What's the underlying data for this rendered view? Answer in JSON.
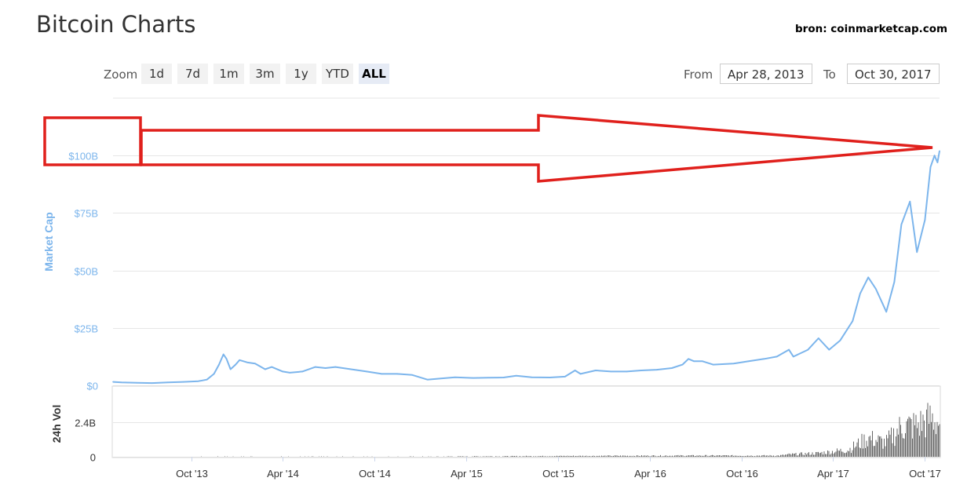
{
  "header": {
    "title": "Bitcoin Charts",
    "source": "bron: coinmarketcap.com"
  },
  "toolbar": {
    "zoom_label": "Zoom",
    "zoom_options": [
      "1d",
      "7d",
      "1m",
      "3m",
      "1y",
      "YTD",
      "ALL"
    ],
    "zoom_selected": "ALL",
    "from_label": "From",
    "from_value": "Apr 28, 2013",
    "to_label": "To",
    "to_value": "Oct 30, 2017"
  },
  "chart_data": [
    {
      "type": "line",
      "ylabel": "Market Cap",
      "y_ticks": [
        0,
        25,
        50,
        75,
        100
      ],
      "y_tick_labels": [
        "$0",
        "$25B",
        "$50B",
        "$75B",
        "$100B"
      ],
      "ylim": [
        0,
        125
      ],
      "y_unit": "billion USD",
      "xlim": [
        "2013-04-28",
        "2017-10-30"
      ],
      "x_ticks": [
        "2013-10-01",
        "2014-04-01",
        "2014-10-01",
        "2015-04-01",
        "2015-10-01",
        "2016-04-01",
        "2016-10-01",
        "2017-04-01",
        "2017-10-01"
      ],
      "x_tick_labels": [
        "Oct '13",
        "Apr '14",
        "Oct '14",
        "Apr '15",
        "Oct '15",
        "Apr '16",
        "Oct '16",
        "Apr '17",
        "Oct '17"
      ],
      "grid": true,
      "color": "#7cb5ec",
      "points": [
        [
          "2013-04-28",
          1.5
        ],
        [
          "2013-05-15",
          1.3
        ],
        [
          "2013-06-15",
          1.1
        ],
        [
          "2013-07-15",
          1.0
        ],
        [
          "2013-08-15",
          1.3
        ],
        [
          "2013-09-15",
          1.5
        ],
        [
          "2013-10-15",
          1.8
        ],
        [
          "2013-11-01",
          2.5
        ],
        [
          "2013-11-15",
          5.0
        ],
        [
          "2013-11-25",
          9.0
        ],
        [
          "2013-12-04",
          13.5
        ],
        [
          "2013-12-10",
          11.5
        ],
        [
          "2013-12-18",
          7.0
        ],
        [
          "2013-12-28",
          9.0
        ],
        [
          "2014-01-05",
          11.0
        ],
        [
          "2014-01-20",
          10.0
        ],
        [
          "2014-02-05",
          9.5
        ],
        [
          "2014-02-25",
          7.0
        ],
        [
          "2014-03-10",
          8.0
        ],
        [
          "2014-04-01",
          6.0
        ],
        [
          "2014-04-15",
          5.5
        ],
        [
          "2014-05-10",
          6.0
        ],
        [
          "2014-06-05",
          8.0
        ],
        [
          "2014-06-25",
          7.5
        ],
        [
          "2014-07-15",
          8.0
        ],
        [
          "2014-08-15",
          7.0
        ],
        [
          "2014-09-15",
          6.0
        ],
        [
          "2014-10-15",
          5.0
        ],
        [
          "2014-11-15",
          5.0
        ],
        [
          "2014-12-15",
          4.5
        ],
        [
          "2015-01-14",
          2.5
        ],
        [
          "2015-02-10",
          3.0
        ],
        [
          "2015-03-10",
          3.5
        ],
        [
          "2015-04-15",
          3.2
        ],
        [
          "2015-05-15",
          3.3
        ],
        [
          "2015-06-15",
          3.4
        ],
        [
          "2015-07-10",
          4.2
        ],
        [
          "2015-08-10",
          3.5
        ],
        [
          "2015-09-15",
          3.4
        ],
        [
          "2015-10-15",
          3.8
        ],
        [
          "2015-11-04",
          6.5
        ],
        [
          "2015-11-15",
          5.0
        ],
        [
          "2015-12-15",
          6.5
        ],
        [
          "2016-01-15",
          6.0
        ],
        [
          "2016-02-15",
          6.0
        ],
        [
          "2016-03-15",
          6.5
        ],
        [
          "2016-04-15",
          6.8
        ],
        [
          "2016-05-15",
          7.5
        ],
        [
          "2016-06-05",
          9.0
        ],
        [
          "2016-06-17",
          11.5
        ],
        [
          "2016-06-28",
          10.5
        ],
        [
          "2016-07-15",
          10.5
        ],
        [
          "2016-08-05",
          9.0
        ],
        [
          "2016-09-15",
          9.5
        ],
        [
          "2016-10-15",
          10.5
        ],
        [
          "2016-11-15",
          11.5
        ],
        [
          "2016-12-10",
          12.5
        ],
        [
          "2017-01-03",
          15.5
        ],
        [
          "2017-01-12",
          12.5
        ],
        [
          "2017-02-10",
          15.5
        ],
        [
          "2017-03-03",
          20.5
        ],
        [
          "2017-03-24",
          15.5
        ],
        [
          "2017-04-15",
          19.5
        ],
        [
          "2017-05-10",
          28.0
        ],
        [
          "2017-05-25",
          40.0
        ],
        [
          "2017-06-10",
          47.0
        ],
        [
          "2017-06-25",
          42.0
        ],
        [
          "2017-07-16",
          32.0
        ],
        [
          "2017-08-01",
          45.0
        ],
        [
          "2017-08-15",
          70.0
        ],
        [
          "2017-09-01",
          80.0
        ],
        [
          "2017-09-15",
          58.0
        ],
        [
          "2017-10-01",
          72.0
        ],
        [
          "2017-10-12",
          95.0
        ],
        [
          "2017-10-20",
          100.0
        ],
        [
          "2017-10-26",
          97.0
        ],
        [
          "2017-10-30",
          102.0
        ]
      ]
    },
    {
      "type": "bar",
      "ylabel": "24h Vol",
      "y_ticks": [
        0,
        2.4
      ],
      "y_tick_labels": [
        "0",
        "2.4B"
      ],
      "ylim": [
        0,
        4.8
      ],
      "y_unit": "billion USD",
      "color": "#666666",
      "points": [
        [
          "2013-04-28",
          0.01
        ],
        [
          "2013-12-01",
          0.02
        ],
        [
          "2014-06-01",
          0.02
        ],
        [
          "2015-01-15",
          0.02
        ],
        [
          "2015-11-04",
          0.07
        ],
        [
          "2016-06-15",
          0.1
        ],
        [
          "2016-12-15",
          0.1
        ],
        [
          "2017-01-05",
          0.2
        ],
        [
          "2017-03-01",
          0.3
        ],
        [
          "2017-05-01",
          0.6
        ],
        [
          "2017-06-10",
          1.6
        ],
        [
          "2017-07-15",
          1.2
        ],
        [
          "2017-08-15",
          2.6
        ],
        [
          "2017-09-15",
          2.7
        ],
        [
          "2017-10-15",
          3.3
        ],
        [
          "2017-10-30",
          2.9
        ]
      ]
    }
  ],
  "annotation": {
    "color": "#e0201c"
  }
}
